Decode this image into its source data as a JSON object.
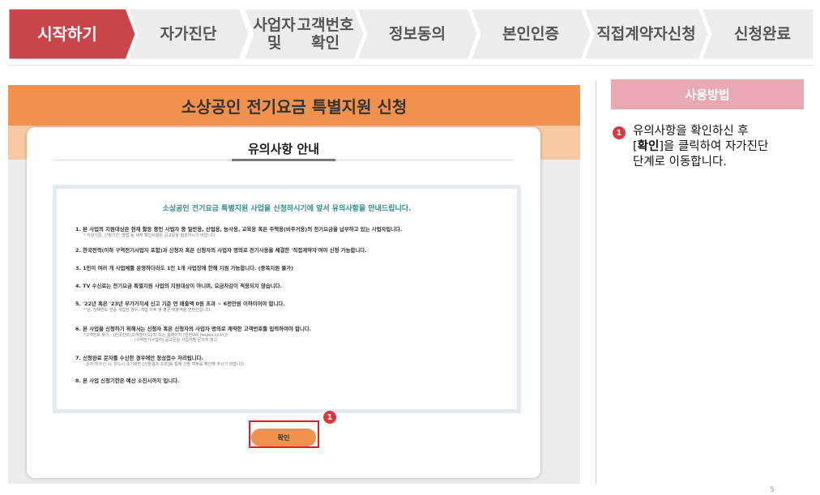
{
  "steps": [
    {
      "label": "시작하기",
      "active": true
    },
    {
      "label": "자가진단"
    },
    {
      "label": "사업자 및\n고객번호확인"
    },
    {
      "label": "정보동의"
    },
    {
      "label": "본인인증"
    },
    {
      "label": "직접계약자\n신청"
    },
    {
      "label": "신청완료"
    }
  ],
  "colors": {
    "active_step": "#c8454a",
    "inactive_step": "#ececec",
    "accent_orange": "#f0924d",
    "badge_red": "#d9363e",
    "usage_header_pink": "#e8a9b3"
  },
  "banner": {
    "title": "소상공인 전기요금 특별지원 신청"
  },
  "card": {
    "title": "유의사항 안내",
    "notice_heading": "소상공인 전기요금 특별지원 사업을 신청하시기에 앞서 유의사항을 안내드립니다.",
    "items": [
      {
        "text": "1. 본 사업의 지원대상은 현재 활동 중인 사업자 중 일반용, 산업용, 농사용, 교육용 혹은 주택용(비주거용)의 전기요금을 납부하고 있는 사업자입니다.",
        "subs": [
          "* 지원기준, 신청기간, 방법 등 세부 확인사항은 공고문을 참조하시기 바랍니다."
        ]
      },
      {
        "text": "2. 한국전력(이하 구역전기사업자 포함)과 신청자 혹은 신청자의 사업자 명의로 전기사용을 체결한 '직접계약자'여야 신청 가능합니다.",
        "subs": []
      },
      {
        "text": "3. 1인이 여러 개 사업체를 운영하더라도 1인 1개 사업장에 한해 지원 가능합니다. (중복지원 불가)",
        "subs": []
      },
      {
        "text": "4. TV 수신료는 전기요금 특별지원 사업의 지원대상이 아니며, 요금차감이 적용되지 않습니다.",
        "subs": []
      },
      {
        "text": "5. '22년 혹은 '23년 부가가치세 신고 기준 연 매출액 0원 초과 ~ 6천만원 이하이어야 합니다.",
        "subs": [
          "* 단, 당해연도 연중 개업한 경우, 개업 이후 월 평균 매출액을 연환산합니다."
        ]
      },
      {
        "text": "6. 본 사업을 신청하기 위해서는 신청자 혹은 신청자의 사업자 명의로 계약한 고객번호를 입력하여야 합니다.",
        "subs": [
          "*고객번호 찾기 : (한국전력)고객센터(123) 또는 홈페이지 (한전ON (kepco.co.kr))",
          "(구역전기사업자) 공고문상 사업자별 문의처 참고"
        ]
      },
      {
        "text": "7. 신청완료 문자를 수신한 경우에만 정상접수 처리됩니다.",
        "subs": [
          "- 문자 미수신 시, 반드시 초기화면 [신청결과 조회]를 통해 신청 여부를 확인해 주시기 바랍니다."
        ]
      },
      {
        "text": "8. 본 사업 신청기한은 예산 소진시까지 입니다.",
        "subs": []
      }
    ],
    "confirm_label": "확인",
    "badge_number": "1"
  },
  "usage": {
    "title": "사용방법",
    "badge_number": "1",
    "line1": "유의사항을 확인하신 후",
    "line2_before": "[",
    "line2_bold": "확인",
    "line2_after": "]을 클릭하여 자가진단",
    "line3": "단계로 이동합니다."
  },
  "page_number": "5"
}
